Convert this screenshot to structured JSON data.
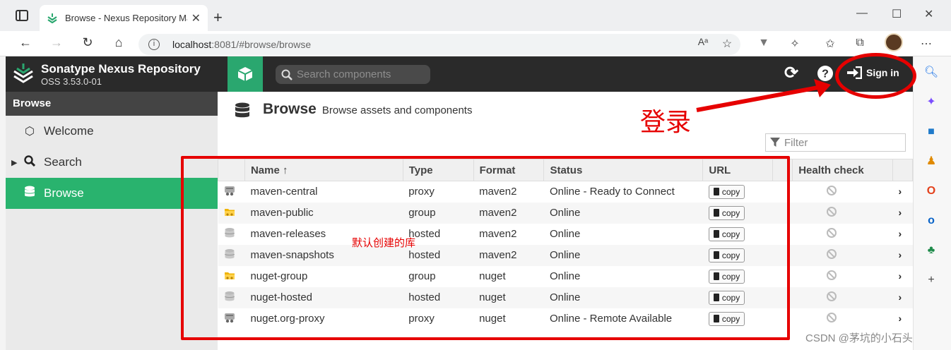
{
  "browser": {
    "tab_title": "Browse - Nexus Repository Mana",
    "url_host": "localhost",
    "url_path": ":8081/#browse/browse"
  },
  "app": {
    "brand": "Sonatype Nexus Repository",
    "version": "OSS 3.53.0-01",
    "search_placeholder": "Search components",
    "sign_in": "Sign in",
    "accent_color": "#29b36e"
  },
  "sidebar": {
    "section": "Browse",
    "items": [
      {
        "label": "Welcome",
        "icon": "hexagon-icon"
      },
      {
        "label": "Search",
        "icon": "search-icon"
      },
      {
        "label": "Browse",
        "icon": "database-icon"
      }
    ]
  },
  "main": {
    "title": "Browse",
    "subtitle": "Browse assets and components",
    "filter_placeholder": "Filter",
    "columns": {
      "name": "Name ↑",
      "type": "Type",
      "format": "Format",
      "status": "Status",
      "url": "URL",
      "health": "Health check"
    },
    "copy_label": "copy",
    "repos": [
      {
        "name": "maven-central",
        "type": "proxy",
        "format": "maven2",
        "status": "Online - Ready to Connect",
        "icon": "proxy-repo-icon"
      },
      {
        "name": "maven-public",
        "type": "group",
        "format": "maven2",
        "status": "Online",
        "icon": "group-repo-icon"
      },
      {
        "name": "maven-releases",
        "type": "hosted",
        "format": "maven2",
        "status": "Online",
        "icon": "hosted-repo-icon"
      },
      {
        "name": "maven-snapshots",
        "type": "hosted",
        "format": "maven2",
        "status": "Online",
        "icon": "hosted-repo-icon"
      },
      {
        "name": "nuget-group",
        "type": "group",
        "format": "nuget",
        "status": "Online",
        "icon": "group-repo-icon"
      },
      {
        "name": "nuget-hosted",
        "type": "hosted",
        "format": "nuget",
        "status": "Online",
        "icon": "hosted-repo-icon"
      },
      {
        "name": "nuget.org-proxy",
        "type": "proxy",
        "format": "nuget",
        "status": "Online - Remote Available",
        "icon": "proxy-repo-icon"
      }
    ]
  },
  "annotations": {
    "login_label": "登录",
    "default_repos_label": "默认创建的库",
    "color": "#e60000"
  },
  "watermark": "CSDN @茅坑的小石头"
}
